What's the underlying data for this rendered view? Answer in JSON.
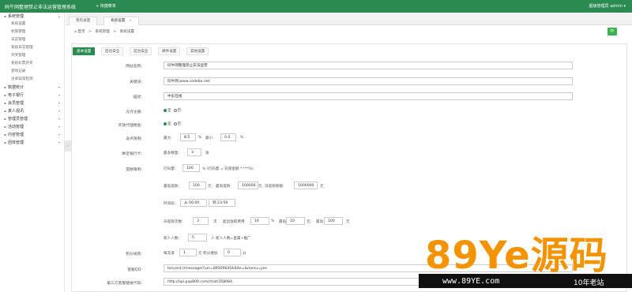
{
  "topbar": {
    "title": "码牛网整理禁止非法运营管理系统",
    "quick_menu": "+ 快捷菜单",
    "right": "超级管理员   admin ▾"
  },
  "sidebar": {
    "items": [
      {
        "label": "系统管理",
        "type": "group",
        "caret": "▴"
      },
      {
        "label": "系统设置",
        "type": "sub"
      },
      {
        "label": "权限管理",
        "type": "sub"
      },
      {
        "label": "日志管理",
        "type": "sub"
      },
      {
        "label": "系统日志管理",
        "type": "sub"
      },
      {
        "label": "开奖管理",
        "type": "sub"
      },
      {
        "label": "系统彩票开奖",
        "type": "sub"
      },
      {
        "label": "游戏记录",
        "type": "sub"
      },
      {
        "label": "注单异常检测",
        "type": "sub"
      },
      {
        "label": "数据统计",
        "type": "group",
        "caret": "▾"
      },
      {
        "label": "电子银行",
        "type": "group",
        "caret": "▾"
      },
      {
        "label": "会员管理",
        "type": "group",
        "caret": "▾"
      },
      {
        "label": "真人视讯",
        "type": "group",
        "caret": "▾"
      },
      {
        "label": "管理员管理",
        "type": "group",
        "caret": "▾"
      },
      {
        "label": "活动管理",
        "type": "group",
        "caret": "▾"
      },
      {
        "label": "内容管理",
        "type": "group",
        "caret": "▾"
      },
      {
        "label": "团体管理",
        "type": "group",
        "caret": "▾"
      }
    ],
    "collapse_glyph": "‹"
  },
  "tabs": [
    {
      "label": "我的桌面"
    },
    {
      "label": "系统设置",
      "close": "×"
    }
  ],
  "breadcrumb": {
    "home": "⌂ 首页",
    "sep": ">",
    "level1": "系统管理",
    "level2": "系统设置"
  },
  "refresh_glyph": "⟳",
  "subtabs": [
    "基本设置",
    "后台安全",
    "前台安全",
    "邮件设置",
    "其他设置"
  ],
  "form": {
    "site_name_label": "网站名称:",
    "site_name_value": "码牛网整理禁止非法运营",
    "keywords_label": "关键词:",
    "keywords_value": "码牛网,www.codeba.net",
    "desc_label": "描述:",
    "desc_value": "中彩在线",
    "allow_register_label": "允许注册:",
    "allow_register_yes": "是",
    "allow_register_no": "否",
    "open_agent_label": "开放代理佣金:",
    "open_agent_yes": "是",
    "open_agent_no": "否",
    "rebate_label": "返点限制:",
    "rebate_max_prefix": "最大:",
    "rebate_max_value": "8.5",
    "rebate_max_unit": "%",
    "rebate_min_prefix": "最小:",
    "rebate_min_value": "0.0",
    "rebate_min_unit": "%",
    "bind_card_label": "绑定银行卡:",
    "bind_card_prefix": "最多数量:",
    "bind_card_value": "3",
    "bind_card_unit": "张",
    "withdraw_label": "提款限制:",
    "discount_prefix": "打码量:",
    "discount_value": "100",
    "discount_desc": "% (打码量 = 充值金额 * ***%)",
    "min_withdraw_prefix": "最低提款:",
    "min_withdraw_value": "100",
    "min_withdraw_unit": "元",
    "max_withdraw_prefix": "最高提款:",
    "max_withdraw_value": "100000",
    "max_withdraw_unit": "元",
    "day_max_prefix": "日提款限额:",
    "day_max_value": "1000000",
    "day_max_unit": "元",
    "time_prefix": "时间段:",
    "time_from": "从 00:00",
    "time_to": "到 23:59",
    "day_count_prefix": "日提款次数:",
    "day_count_value": "3",
    "day_count_unit": "次",
    "over_fee_prefix": "超出收取费用",
    "over_fee_value": "10",
    "over_fee_unit": "%",
    "min_fee_prefix": "最低",
    "min_fee_value": "10",
    "min_fee_unit": "元;",
    "max_fee_prefix": "最高",
    "max_fee_value": "100",
    "max_fee_unit": "元",
    "newbie_prefix": "新人人数:",
    "newbie_value": "5",
    "newbie_desc": "人  新人人数=直属+推广",
    "points_label": "积分规则:",
    "points_prefix": "每充值",
    "points_value": "1",
    "points_mid": "元  积分增加",
    "points_value2": "0",
    "points_unit": "分",
    "qq_label": "客服QQ:",
    "qq_value": "tencent://message/?uin=89309645&Site=&menu=yes",
    "chat_label": "第三方客服链接代码:",
    "chat_value": "http://api.pop800.com/chat/358084"
  },
  "watermark": {
    "big": "89Ye源码",
    "url": "www.89YE.com",
    "tag": "10年老站"
  },
  "colors": {
    "brand": "#2a8a4f",
    "watermark": "#f39300"
  }
}
